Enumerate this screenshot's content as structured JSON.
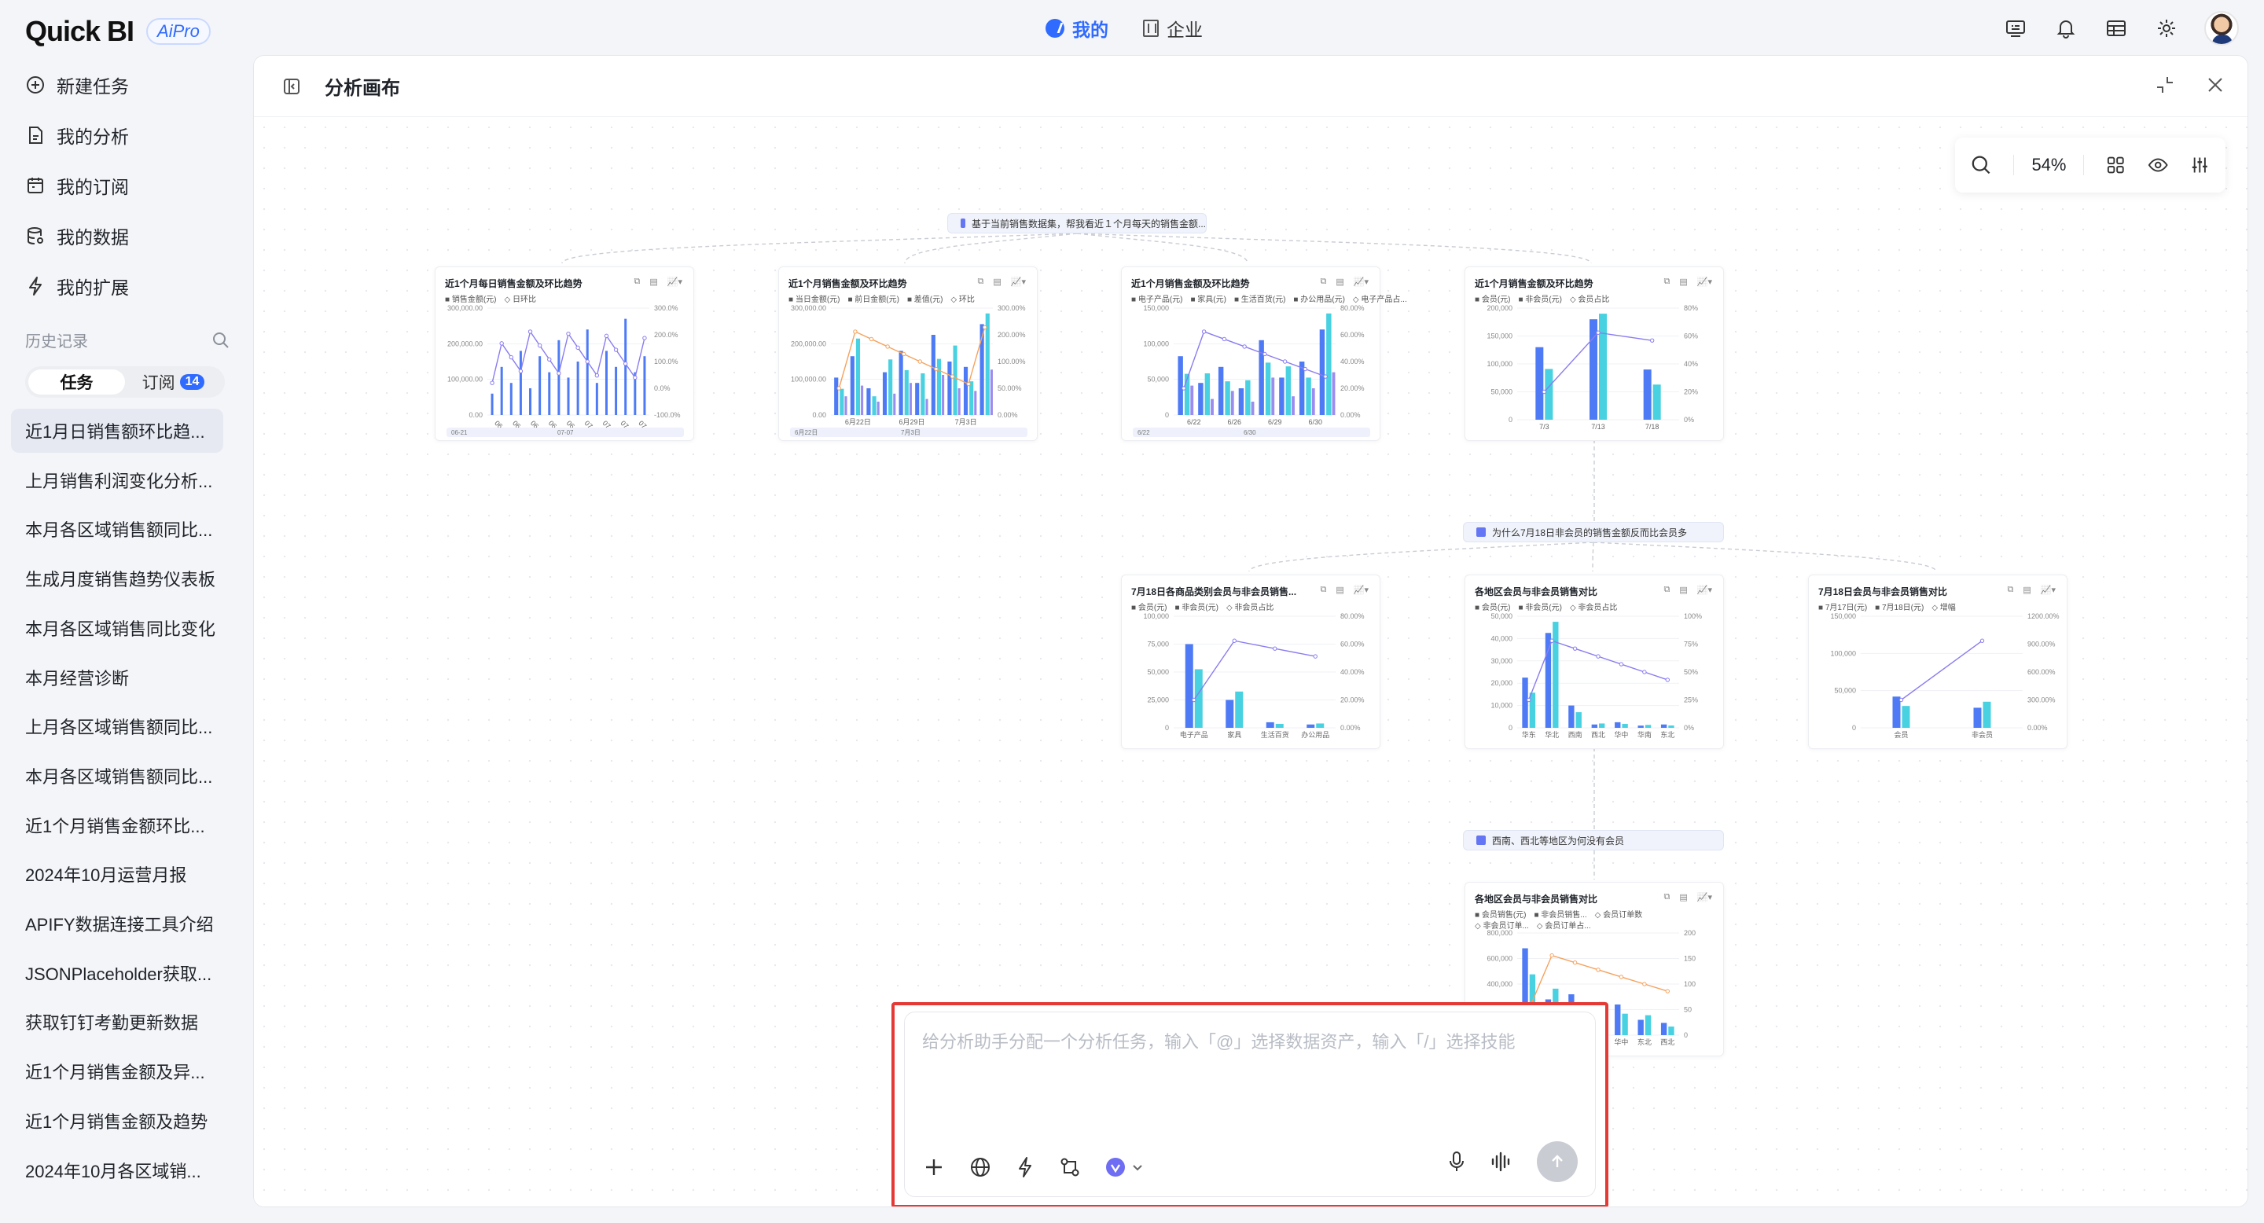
{
  "brand": {
    "logo": "Quick BI",
    "badge": "AiPro"
  },
  "topnav": [
    {
      "label": "我的",
      "active": true
    },
    {
      "label": "企业",
      "active": false
    }
  ],
  "topicons": [
    "screen-icon",
    "bell-icon",
    "table-icon",
    "gear-icon",
    "avatar"
  ],
  "sidebar": {
    "menu": [
      {
        "label": "新建任务",
        "icon": "plus-circle-icon"
      },
      {
        "label": "我的分析",
        "icon": "document-icon"
      },
      {
        "label": "我的订阅",
        "icon": "calendar-icon"
      },
      {
        "label": "我的数据",
        "icon": "database-icon"
      },
      {
        "label": "我的扩展",
        "icon": "lightning-icon"
      }
    ],
    "history_label": "历史记录",
    "tabs": [
      {
        "label": "任务"
      },
      {
        "label": "订阅",
        "badge": "14"
      }
    ],
    "history": [
      "近1月日销售额环比趋...",
      "上月销售利润变化分析...",
      "本月各区域销售额同比...",
      "生成月度销售趋势仪表板",
      "本月各区域销售同比变化",
      "本月经营诊断",
      "上月各区域销售额同比...",
      "本月各区域销售额同比...",
      "近1个月销售金额环比...",
      "2024年10月运营月报",
      "APIFY数据连接工具介绍",
      "JSONPlaceholder获取...",
      "获取钉钉考勤更新数据",
      "近1个月销售金额及异...",
      "近1个月销售金额及趋势",
      "2024年10月各区域销..."
    ]
  },
  "panel": {
    "title": "分析画布",
    "zoom": "54%"
  },
  "canvas": {
    "nodes": [
      "基于当前销售数据集，帮我看近１个月每天的销售金额...",
      "为什么7月18日非会员的销售金额反而比会员多",
      "西南、西北等地区为何没有会员"
    ],
    "cards": [
      {
        "title": "近1个月每日销售金额及环比趋势",
        "legend": "■ 销售金额(元)　◇ 日环比",
        "axis_left": [
          "300,000.00",
          "200,000.00",
          "100,000.00",
          "0.00"
        ],
        "axis_right": [
          "300.0%",
          "200.0%",
          "100.0%",
          "0.0%",
          "-100.0%"
        ],
        "xlabels": [
          "06-21",
          "06-23",
          "06-25",
          "06-27",
          "06-29",
          "07-01",
          "07-03",
          "07-05",
          "07-07"
        ],
        "range": [
          "06-21",
          "07-07"
        ]
      },
      {
        "title": "近1个月销售金额及环比趋势",
        "legend": "■ 当日金额(元)　■ 前日金额(元)　■ 差值(元)　◇ 环比",
        "axis_left": [
          "300,000.00",
          "200,000.00",
          "100,000.00",
          "0.00"
        ],
        "axis_right": [
          "300.00%",
          "200.00%",
          "100.00%",
          "50.00%",
          "0.00%"
        ],
        "xlabels": [
          "6月22日",
          "6月29日",
          "7月3日"
        ],
        "range": [
          "6月22日",
          "7月3日"
        ]
      },
      {
        "title": "近1个月销售金额及环比趋势",
        "legend": "■ 电子产品(元)　■ 家具(元)　■ 生活百货(元)　■ 办公用品(元)　◇ 电子产品占...",
        "axis_left": [
          "150,000",
          "100,000",
          "50,000",
          "0"
        ],
        "axis_right": [
          "80.00%",
          "60.00%",
          "40.00%",
          "20.00%",
          "0.00%"
        ],
        "xlabels": [
          "6/22",
          "6/26",
          "6/29",
          "6/30"
        ],
        "range": [
          "6/22",
          "6/30"
        ]
      },
      {
        "title": "近1个月销售金额及环比趋势",
        "legend": "■ 会员(元)　■ 非会员(元)　◇ 会员占比",
        "axis_left": [
          "200,000",
          "150,000",
          "100,000",
          "50,000",
          "0"
        ],
        "axis_right": [
          "80%",
          "60%",
          "40%",
          "20%",
          "0%"
        ],
        "xlabels": [
          "7/3",
          "7/13",
          "7/18"
        ]
      },
      {
        "title": "7月18日各商品类别会员与非会员销售...",
        "legend": "■ 会员(元)　■ 非会员(元)　◇ 非会员占比",
        "axis_left": [
          "100,000",
          "75,000",
          "50,000",
          "25,000",
          "0"
        ],
        "axis_right": [
          "80.00%",
          "60.00%",
          "40.00%",
          "20.00%",
          "0.00%"
        ],
        "xlabels": [
          "电子产品",
          "家具",
          "生活百货",
          "办公用品"
        ]
      },
      {
        "title": "各地区会员与非会员销售对比",
        "legend": "■ 会员(元)　■ 非会员(元)　◇ 非会员占比",
        "axis_left": [
          "50,000",
          "40,000",
          "30,000",
          "20,000",
          "10,000",
          "0"
        ],
        "axis_right": [
          "100%",
          "75%",
          "50%",
          "25%",
          "0%"
        ],
        "xlabels": [
          "华东",
          "华北",
          "西南",
          "西北",
          "华中",
          "华南",
          "东北"
        ]
      },
      {
        "title": "7月18日会员与非会员销售对比",
        "legend": "■ 7月17日(元)　■ 7月18日(元)　◇ 增幅",
        "axis_left": [
          "150,000",
          "100,000",
          "50,000",
          "0"
        ],
        "axis_right": [
          "1200.00%",
          "900.00%",
          "600.00%",
          "300.00%",
          "0.00%"
        ],
        "xlabels": [
          "会员",
          "非会员"
        ]
      },
      {
        "title": "各地区会员与非会员销售对比",
        "legend": "■ 会员销售(元)　■ 非会员销售...　◇ 会员订单数",
        "legend2": "◇ 非会员订单...　◇ 会员订单占...",
        "axis_left": [
          "800,000",
          "600,000",
          "400,000",
          "200,000",
          "0"
        ],
        "axis_right": [
          "200",
          "150",
          "100",
          "50",
          "0"
        ],
        "xlabels": [
          "华东",
          "华北",
          "华南",
          "西南",
          "华中",
          "东北",
          "西北"
        ]
      }
    ]
  },
  "chat": {
    "placeholder": "给分析助手分配一个分析任务，输入「@」选择数据资产，输入「/」选择技能"
  },
  "colors": {
    "accent": "#2f6bff",
    "bar_blue": "#4e7bf5",
    "bar_cyan": "#48d1e0",
    "bar_purple": "#9b8cf0",
    "line_orange": "#f5a25d",
    "highlight": "#e53935"
  }
}
